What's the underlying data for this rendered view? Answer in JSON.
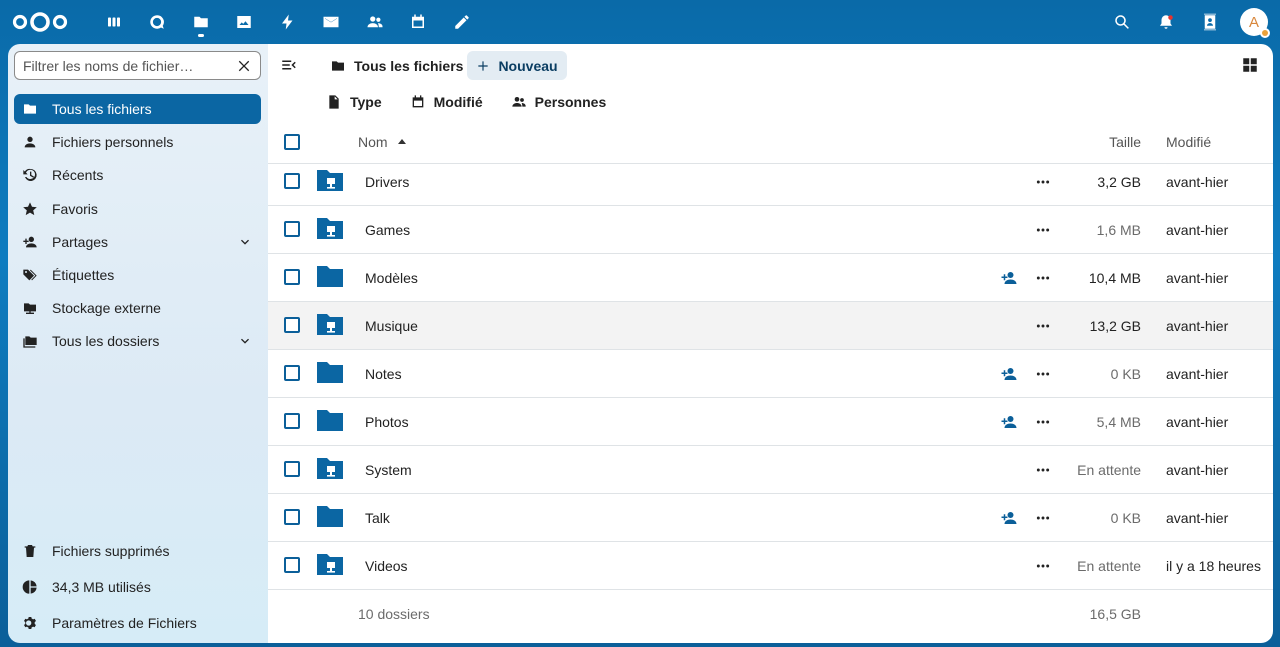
{
  "header": {
    "apps": [
      {
        "name": "dashboard",
        "icon": "dashboard-icon"
      },
      {
        "name": "talk",
        "icon": "talk-icon"
      },
      {
        "name": "files",
        "icon": "folder-icon",
        "active": true
      },
      {
        "name": "photos",
        "icon": "image-icon"
      },
      {
        "name": "activity",
        "icon": "lightning-icon"
      },
      {
        "name": "mail",
        "icon": "mail-icon"
      },
      {
        "name": "contacts",
        "icon": "contacts-icon"
      },
      {
        "name": "calendar",
        "icon": "calendar-icon"
      },
      {
        "name": "notes",
        "icon": "pencil-icon"
      }
    ],
    "avatar_letter": "A"
  },
  "sidebar": {
    "filter_placeholder": "Filtrer les noms de fichier…",
    "items": [
      {
        "label": "Tous les fichiers",
        "icon": "folder-icon",
        "active": true
      },
      {
        "label": "Fichiers personnels",
        "icon": "person-icon"
      },
      {
        "label": "Récents",
        "icon": "history-icon"
      },
      {
        "label": "Favoris",
        "icon": "star-icon"
      },
      {
        "label": "Partages",
        "icon": "share-icon",
        "expandable": true
      },
      {
        "label": "Étiquettes",
        "icon": "tag-icon"
      },
      {
        "label": "Stockage externe",
        "icon": "external-storage-icon"
      },
      {
        "label": "Tous les dossiers",
        "icon": "folders-icon",
        "expandable": true
      }
    ],
    "bottom": {
      "trash": "Fichiers supprimés",
      "quota": "34,3 MB utilisés",
      "settings": "Paramètres de Fichiers"
    }
  },
  "main": {
    "breadcrumb": "Tous les fichiers",
    "new_button": "Nouveau",
    "filters": {
      "type": "Type",
      "modified": "Modifié",
      "people": "Personnes"
    },
    "columns": {
      "name": "Nom",
      "size": "Taille",
      "modified": "Modifié"
    },
    "rows": [
      {
        "name": "Drivers",
        "size": "3,2 GB",
        "modified": "avant-hier",
        "external": true,
        "shared": false,
        "grey": false
      },
      {
        "name": "Games",
        "size": "1,6 MB",
        "modified": "avant-hier",
        "external": true,
        "shared": false,
        "grey": true
      },
      {
        "name": "Modèles",
        "size": "10,4 MB",
        "modified": "avant-hier",
        "external": false,
        "shared": true,
        "grey": false
      },
      {
        "name": "Musique",
        "size": "13,2 GB",
        "modified": "avant-hier",
        "external": true,
        "shared": false,
        "grey": false
      },
      {
        "name": "Notes",
        "size": "0 KB",
        "modified": "avant-hier",
        "external": false,
        "shared": true,
        "grey": true
      },
      {
        "name": "Photos",
        "size": "5,4 MB",
        "modified": "avant-hier",
        "external": false,
        "shared": true,
        "grey": true
      },
      {
        "name": "System",
        "size": "En attente",
        "modified": "avant-hier",
        "external": true,
        "shared": false,
        "grey": true
      },
      {
        "name": "Talk",
        "size": "0 KB",
        "modified": "avant-hier",
        "external": false,
        "shared": true,
        "grey": true
      },
      {
        "name": "Videos",
        "size": "En attente",
        "modified": "il y a 18 heures",
        "external": true,
        "shared": false,
        "grey": true
      }
    ],
    "summary": {
      "count": "10 dossiers",
      "total": "16,5 GB"
    }
  },
  "colors": {
    "primary": "#0b66a3",
    "folder": "#0b66a3"
  }
}
